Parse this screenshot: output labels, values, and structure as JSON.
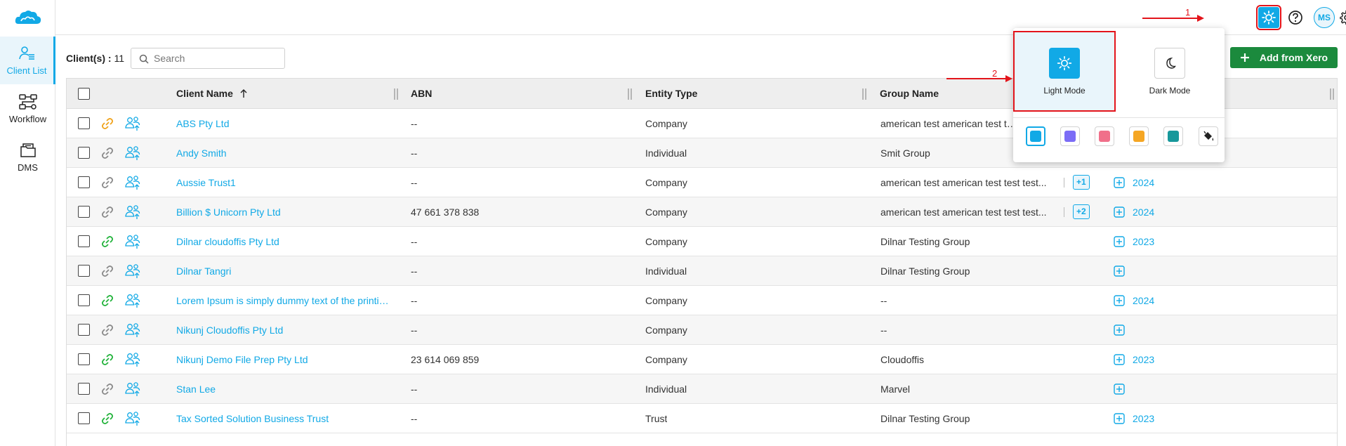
{
  "sidebar": {
    "items": [
      {
        "label": "Client List",
        "icon": "client-list-icon",
        "active": true
      },
      {
        "label": "Workflow",
        "icon": "workflow-icon",
        "active": false
      },
      {
        "label": "DMS",
        "icon": "dms-folder-icon",
        "active": false
      }
    ]
  },
  "header": {
    "icons": [
      "theme-sun-icon",
      "help-icon",
      "bell-icon",
      "gear-icon"
    ],
    "avatar_initials": "MS"
  },
  "toolbar": {
    "client_count_label": "Client(s) :",
    "client_count": "11",
    "search_placeholder": "Search",
    "add_from_xero_label": "Add from Xero"
  },
  "table": {
    "columns": [
      "Client Name",
      "ABN",
      "Entity Type",
      "Group Name"
    ],
    "sort_column": "Client Name",
    "sort_direction": "ascending",
    "rows": [
      {
        "name": "ABS Pty Ltd",
        "abn": "--",
        "entity": "Company",
        "group": "american test american test test test...",
        "badge": "",
        "year": "",
        "link_color": "#f0a31b"
      },
      {
        "name": "Andy Smith",
        "abn": "--",
        "entity": "Individual",
        "group": "Smit Group",
        "badge": "",
        "year": "",
        "link_color": "#8a8a8a"
      },
      {
        "name": "Aussie Trust1",
        "abn": "--",
        "entity": "Company",
        "group": "american test american test test test...",
        "badge": "+1",
        "year": "2024",
        "link_color": "#8a8a8a"
      },
      {
        "name": "Billion $ Unicorn Pty Ltd",
        "abn": "47 661 378 838",
        "entity": "Company",
        "group": "american test american test test test...",
        "badge": "+2",
        "year": "2024",
        "link_color": "#8a8a8a"
      },
      {
        "name": "Dilnar cloudoffis Pty Ltd",
        "abn": "--",
        "entity": "Company",
        "group": "Dilnar Testing Group",
        "badge": "",
        "year": "2023",
        "link_color": "#22b33b"
      },
      {
        "name": "Dilnar Tangri",
        "abn": "--",
        "entity": "Individual",
        "group": "Dilnar Testing Group",
        "badge": "",
        "year": "",
        "link_color": "#8a8a8a"
      },
      {
        "name": "Lorem Ipsum is simply dummy text of the printing and typesetting industry",
        "abn": "--",
        "entity": "Company",
        "group": "--",
        "badge": "",
        "year": "2024",
        "link_color": "#22b33b"
      },
      {
        "name": "Nikunj Cloudoffis Pty Ltd",
        "abn": "--",
        "entity": "Company",
        "group": "--",
        "badge": "",
        "year": "",
        "link_color": "#8a8a8a"
      },
      {
        "name": "Nikunj Demo File Prep Pty Ltd",
        "abn": "23 614 069 859",
        "entity": "Company",
        "group": "Cloudoffis",
        "badge": "",
        "year": "2023",
        "link_color": "#22b33b"
      },
      {
        "name": "Stan Lee",
        "abn": "--",
        "entity": "Individual",
        "group": "Marvel",
        "badge": "",
        "year": "",
        "link_color": "#8a8a8a"
      },
      {
        "name": "Tax Sorted Solution Business Trust",
        "abn": "--",
        "entity": "Trust",
        "group": "Dilnar Testing Group",
        "badge": "",
        "year": "2023",
        "link_color": "#22b33b"
      }
    ]
  },
  "theme_popup": {
    "modes": [
      {
        "label": "Light Mode",
        "icon": "sun-icon",
        "selected": true
      },
      {
        "label": "Dark Mode",
        "icon": "moon-icon",
        "selected": false
      }
    ],
    "swatches": [
      "#11a9e6",
      "#7b6cf6",
      "#f0708a",
      "#f5a623",
      "#17989b",
      "custom-paint-bucket-icon"
    ],
    "selected_swatch": "#11a9e6"
  },
  "annotations": [
    {
      "number": "1",
      "target": "theme-button"
    },
    {
      "number": "2",
      "target": "light-mode-option"
    }
  ],
  "colors": {
    "accent": "#11a9e6",
    "primary_action": "#1b8a3d",
    "annotation": "#e3141b"
  }
}
